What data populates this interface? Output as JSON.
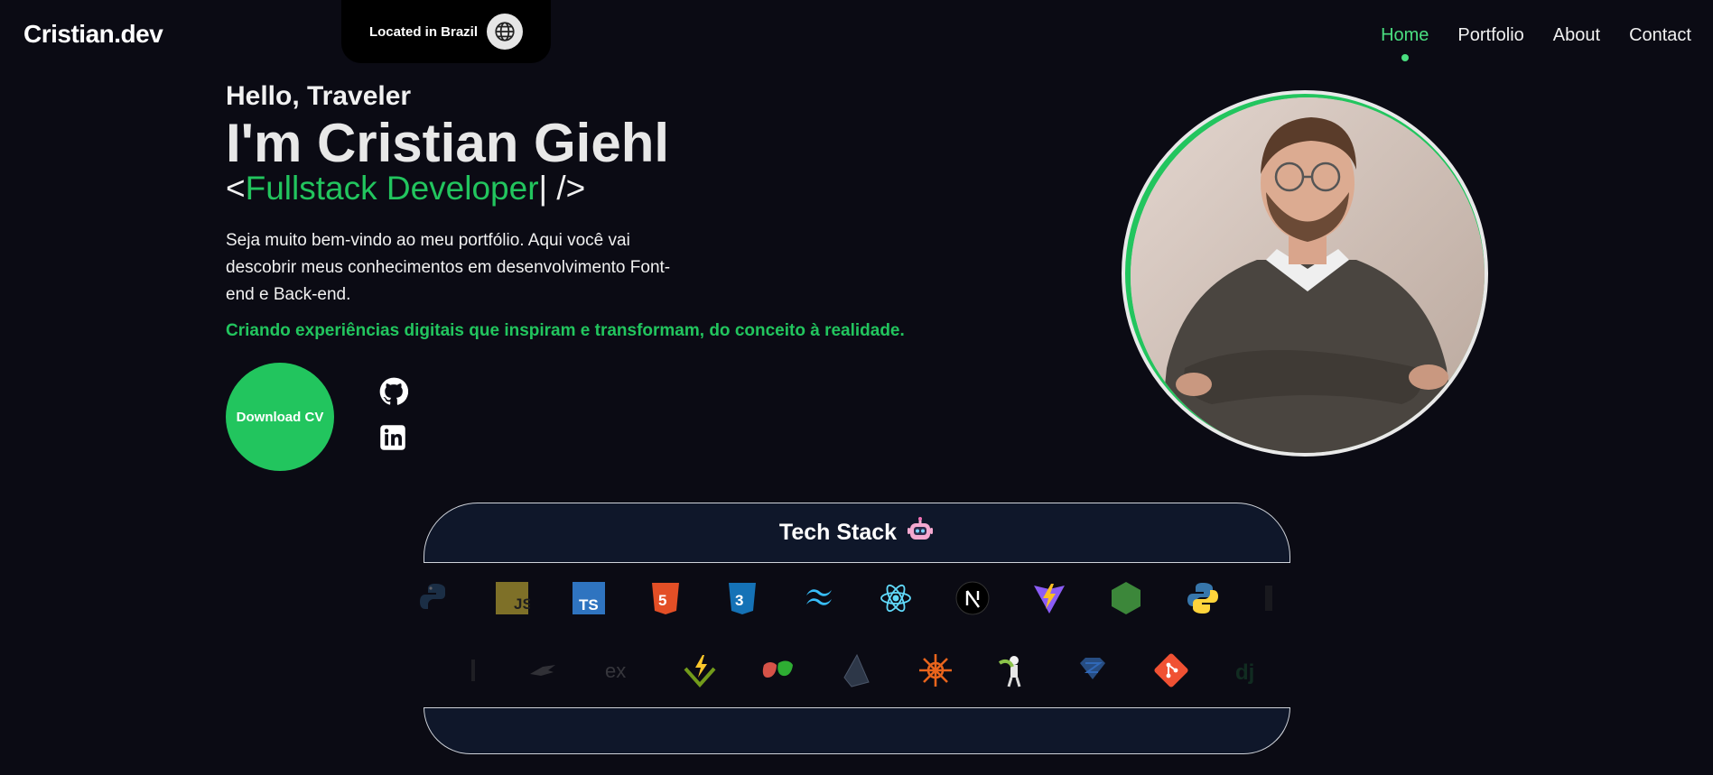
{
  "header": {
    "logo_name": "Cristian",
    "logo_dot": ".",
    "logo_tld": "dev",
    "location_text": "Located in Brazil",
    "nav": [
      {
        "label": "Home",
        "active": true
      },
      {
        "label": "Portfolio",
        "active": false
      },
      {
        "label": "About",
        "active": false
      },
      {
        "label": "Contact",
        "active": false
      }
    ]
  },
  "hero": {
    "greeting": "Hello, Traveler",
    "name": "I'm Cristian Giehl",
    "role_open": "<",
    "role_highlight": "Fullstack Developer",
    "role_close": "| />",
    "intro": "Seja muito bem-vindo ao meu portfólio. Aqui você vai descobrir meus conhecimentos em desenvolvimento Font-end e Back-end.",
    "tagline": "Criando experiências digitais que inspiram e transformam, do conceito à realidade.",
    "cv_button": "Download CV",
    "social": [
      "github-icon",
      "linkedin-icon"
    ]
  },
  "tech_stack": {
    "title": "Tech Stack",
    "row1": [
      "python",
      "javascript",
      "typescript",
      "html5",
      "css3",
      "tailwind",
      "react",
      "nextjs",
      "vite",
      "nodejs",
      "python",
      "unknown"
    ],
    "row2": [
      "unknown",
      "prisma-like",
      "express",
      "vitest",
      "playwright",
      "prisma",
      "kafka",
      "cypress",
      "zod",
      "git",
      "django"
    ]
  },
  "colors": {
    "accent": "#22c55e",
    "nav_active": "#4ade80",
    "background": "#0b0b14",
    "panel": "#0f172a"
  }
}
